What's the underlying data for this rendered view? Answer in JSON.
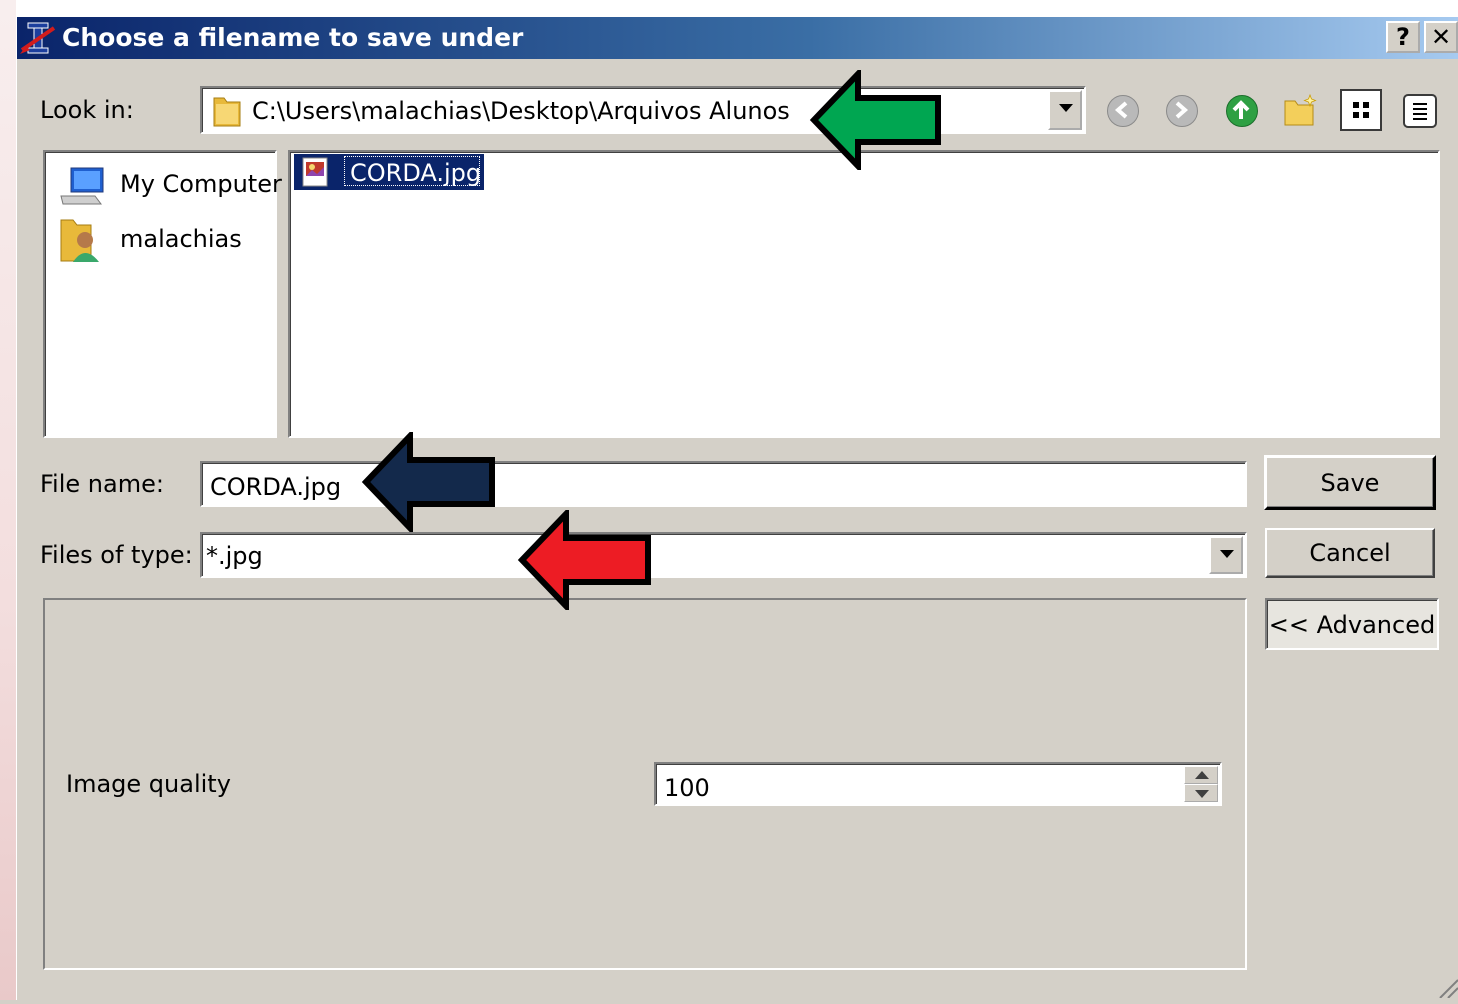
{
  "window": {
    "title": "Choose a filename to save under",
    "help_label": "?",
    "close_label": "✕"
  },
  "look_in": {
    "label": "Look in:",
    "path": "C:\\Users\\malachias\\Desktop\\Arquivos Alunos"
  },
  "toolbar": {
    "icons": [
      "back-icon",
      "forward-icon",
      "up-folder-icon",
      "new-folder-icon",
      "list-view-icon",
      "detail-view-icon"
    ]
  },
  "sidebar": {
    "items": [
      {
        "label": "My Computer",
        "icon": "computer-icon"
      },
      {
        "label": "malachias",
        "icon": "user-folder-icon"
      }
    ]
  },
  "files": [
    {
      "name": "CORDA.jpg",
      "selected": true,
      "icon": "image-file-icon"
    }
  ],
  "file_name": {
    "label": "File name:",
    "value": "CORDA.jpg"
  },
  "file_type": {
    "label": "Files of type:",
    "value": "*.jpg"
  },
  "buttons": {
    "save": "Save",
    "cancel": "Cancel",
    "advanced": "<< Advanced"
  },
  "advanced": {
    "quality_label": "Image quality",
    "quality_value": "100"
  },
  "annotations": [
    {
      "name": "green-arrow",
      "color": "#00a651"
    },
    {
      "name": "navy-arrow",
      "color": "#13294b"
    },
    {
      "name": "red-arrow",
      "color": "#ed1c24"
    }
  ],
  "colors": {
    "title_start": "#0a246a",
    "title_end": "#a6caf0",
    "selection": "#0a246a",
    "face": "#d4d0c8"
  }
}
